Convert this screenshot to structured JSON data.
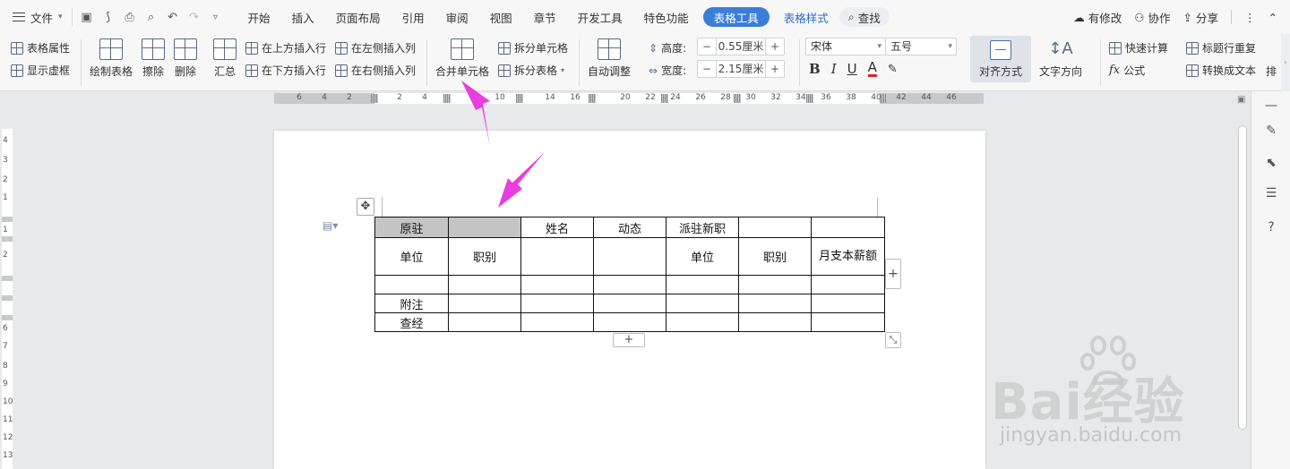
{
  "menubar": {
    "file": "文件",
    "tabs": [
      {
        "label": "开始"
      },
      {
        "label": "插入"
      },
      {
        "label": "页面布局"
      },
      {
        "label": "引用"
      },
      {
        "label": "审阅"
      },
      {
        "label": "视图"
      },
      {
        "label": "章节"
      },
      {
        "label": "开发工具"
      },
      {
        "label": "特色功能"
      },
      {
        "label": "表格工具"
      },
      {
        "label": "表格样式"
      },
      {
        "label": "查找"
      }
    ],
    "right": {
      "modified": "有修改",
      "collab": "协作",
      "share": "分享"
    }
  },
  "ribbon": {
    "table_props": "表格属性",
    "show_gridlines": "显示虚框",
    "draw_table": "绘制表格",
    "erase": "擦除",
    "delete": "删除",
    "summary": "汇总",
    "insert_above": "在上方插入行",
    "insert_below": "在下方插入行",
    "insert_left": "在左侧插入列",
    "insert_right": "在右侧插入列",
    "merge_cells": "合并单元格",
    "split_cells": "拆分单元格",
    "split_table": "拆分表格",
    "auto_adjust": "自动调整",
    "height_label": "高度:",
    "height_value": "0.55厘米",
    "width_label": "宽度:",
    "width_value": "2.15厘米",
    "font_name": "宋体",
    "font_size": "五号",
    "align": "对齐方式",
    "text_direction": "文字方向",
    "quick_calc": "快速计算",
    "formula": "公式",
    "repeat_header": "标题行重复",
    "convert_text": "转换成文本",
    "arrange": "排"
  },
  "ruler": {
    "h_numbers": [
      "6",
      "4",
      "2",
      "2",
      "4",
      "10",
      "14",
      "16",
      "20",
      "22",
      "24",
      "26",
      "28",
      "30",
      "32",
      "34",
      "36",
      "38",
      "40",
      "42",
      "44",
      "46"
    ],
    "v_numbers": [
      "4",
      "3",
      "2",
      "1",
      "1",
      "2",
      "6",
      "7",
      "8",
      "9",
      "10",
      "11",
      "12",
      "13"
    ]
  },
  "table": {
    "rows": [
      [
        "原驻",
        "",
        "姓名",
        "动态",
        "派驻新职",
        "",
        ""
      ],
      [
        "单位",
        "职别",
        "",
        "",
        "单位",
        "职别",
        "月支本薪额"
      ],
      [
        "",
        "",
        "",
        "",
        "",
        "",
        ""
      ],
      [
        "附注",
        "",
        "",
        "",
        "",
        "",
        ""
      ],
      [
        "查经",
        "",
        "",
        "",
        "",
        "",
        ""
      ]
    ]
  },
  "controls": {
    "add_col": "+",
    "add_row": "+",
    "move": "✥"
  },
  "watermark": {
    "brand": "Bai经验",
    "url": "jingyan.baidu.com"
  },
  "colors": {
    "accent": "#3b7ed8",
    "arrow": "#e83ee0",
    "selected_cell": "#c4c4c4"
  },
  "icons": {
    "file": "hamburger-icon",
    "find": "search-icon",
    "modified": "cloud-icon",
    "collab": "user-icon",
    "share": "share-icon"
  }
}
